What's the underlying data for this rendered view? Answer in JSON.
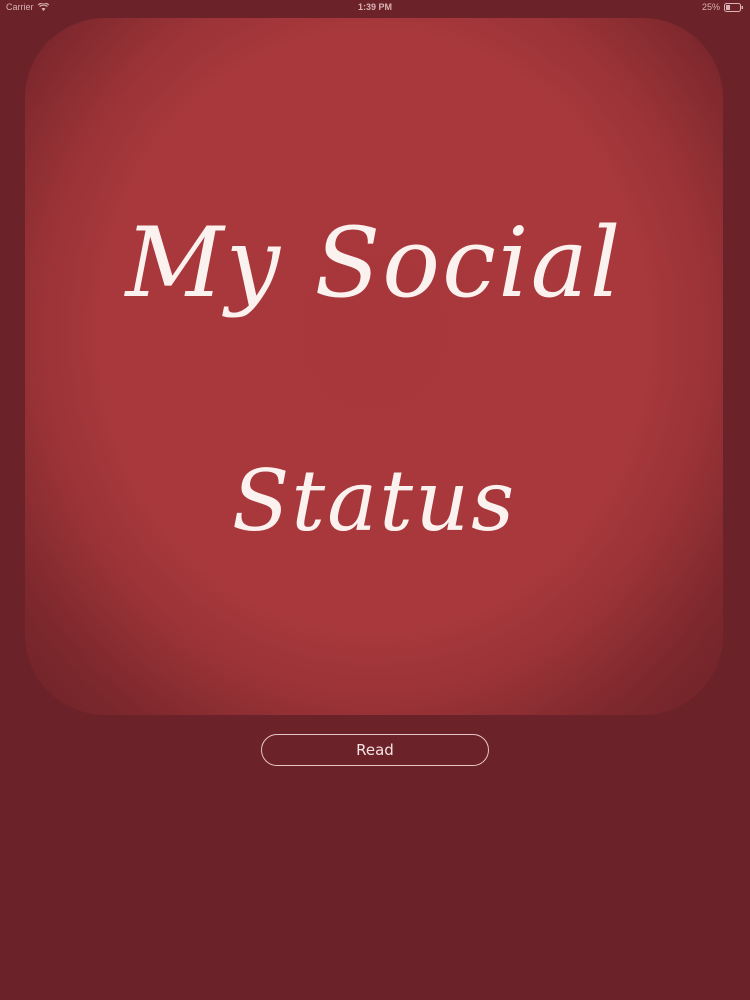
{
  "status_bar": {
    "carrier": "Carrier",
    "time": "1:39 PM",
    "battery": "25%",
    "icons": [
      "wifi-icon",
      "battery-icon"
    ]
  },
  "hero": {
    "line1": "My Social",
    "line2": "Status"
  },
  "actions": {
    "read_label": "Read"
  },
  "colors": {
    "background": "#6b2228",
    "hero": "#a8373b",
    "text": "#fbf2ef"
  }
}
